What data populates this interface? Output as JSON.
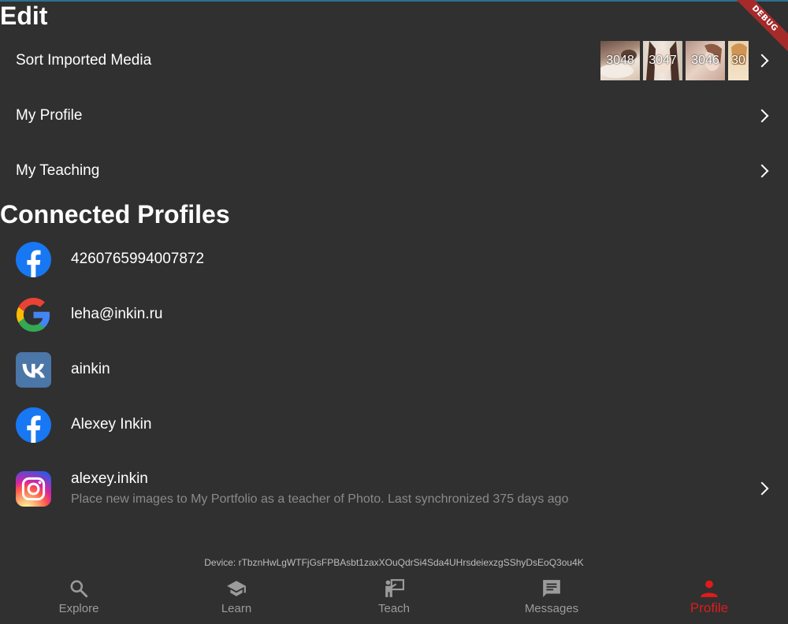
{
  "debug_banner": "DEBUG",
  "edit": {
    "title": "Edit",
    "items": [
      {
        "label": "Sort Imported Media"
      },
      {
        "label": "My Profile"
      },
      {
        "label": "My Teaching"
      }
    ],
    "thumbnails": [
      "3048",
      "3047",
      "3046",
      "30"
    ]
  },
  "connected": {
    "title": "Connected Profiles",
    "profiles": [
      {
        "network": "facebook-icon",
        "title": "4260765994007872"
      },
      {
        "network": "google-icon",
        "title": "leha@inkin.ru"
      },
      {
        "network": "vk-icon",
        "title": "ainkin"
      },
      {
        "network": "facebook-icon",
        "title": "Alexey Inkin"
      },
      {
        "network": "instagram-icon",
        "title": "alexey.inkin",
        "subtitle": "Place new images to My Portfolio as a teacher of Photo. Last synchronized 375 days ago"
      }
    ]
  },
  "device": "Device: rTbznHwLgWTFjGsFPBAsbt1zaxXOuQdrSi4Sda4UHrsdeiexzgSShyDsEoQ3ou4K",
  "nav": {
    "items": [
      {
        "label": "Explore",
        "icon": "search-icon"
      },
      {
        "label": "Learn",
        "icon": "school-icon"
      },
      {
        "label": "Teach",
        "icon": "teacher-icon"
      },
      {
        "label": "Messages",
        "icon": "message-icon"
      },
      {
        "label": "Profile",
        "icon": "person-icon",
        "active": true
      }
    ],
    "active_color": "#e21a1a",
    "inactive_color": "#9b9b9b"
  },
  "colors": {
    "background": "#303030",
    "facebook": "#1877f2",
    "vk": "#4a76a8"
  }
}
